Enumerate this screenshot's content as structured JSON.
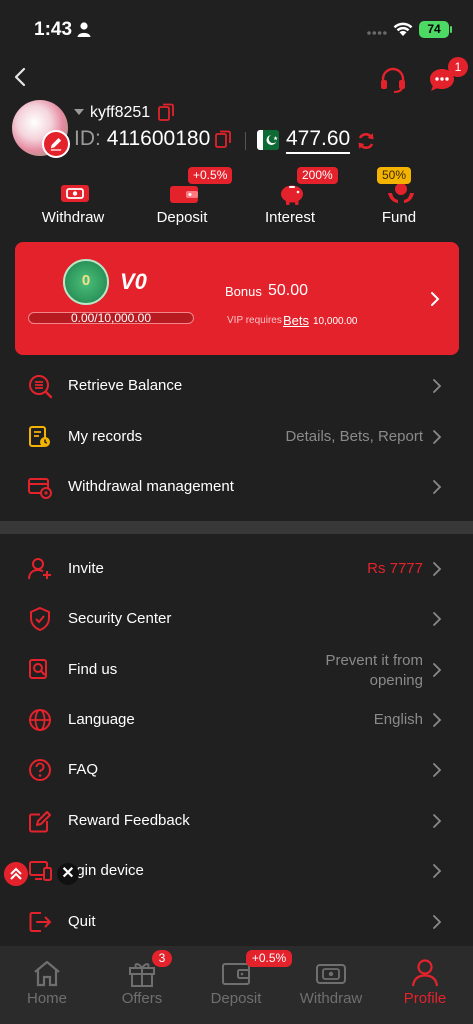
{
  "status_bar": {
    "time": "1:43",
    "battery": "74"
  },
  "header": {
    "message_badge": "1"
  },
  "profile": {
    "username": "kyff8251",
    "id_label": "ID:",
    "id_value": "411600180",
    "balance": "477.60"
  },
  "quick_actions": [
    {
      "label": "Withdraw",
      "badge": ""
    },
    {
      "label": "Deposit",
      "badge": "+0.5%"
    },
    {
      "label": "Interest",
      "badge": "200%"
    },
    {
      "label": "Fund",
      "badge": "50%"
    }
  ],
  "vip": {
    "medal_level": "0",
    "level": "V0",
    "progress_text": "0.00/10,000.00",
    "progress_fraction": 0,
    "bonus_label": "Bonus",
    "bonus_value": "50.00",
    "requires_text": "VIP requires",
    "requires_link": "Bets",
    "requires_amount": "10,000.00"
  },
  "menu_section_1": [
    {
      "label": "Retrieve Balance",
      "value": ""
    },
    {
      "label": "My records",
      "value": "Details, Bets, Report"
    },
    {
      "label": "Withdrawal management",
      "value": ""
    }
  ],
  "menu_section_2": [
    {
      "label": "Invite",
      "value": "Rs 7777"
    },
    {
      "label": "Security Center",
      "value": ""
    },
    {
      "label": "Find us",
      "value_line1": "Prevent it from",
      "value_line2": "opening"
    },
    {
      "label": "Language",
      "value": "English"
    },
    {
      "label": "FAQ",
      "value": ""
    },
    {
      "label": "Reward Feedback",
      "value": ""
    },
    {
      "label": "ogin device",
      "value": ""
    },
    {
      "label": "Quit",
      "value": ""
    }
  ],
  "floating": {
    "close_symbol": "✕"
  },
  "tab_bar": {
    "items": [
      {
        "label": "Home",
        "badge": ""
      },
      {
        "label": "Offers",
        "badge": "3"
      },
      {
        "label": "Deposit",
        "badge": "+0.5%"
      },
      {
        "label": "Withdraw",
        "badge": ""
      },
      {
        "label": "Profile",
        "badge": ""
      }
    ],
    "active": "Profile"
  },
  "colors": {
    "background": "#202020",
    "accent": "#e4222c",
    "muted_text": "#8a8a8a",
    "fund_badge": "#f5b301"
  }
}
